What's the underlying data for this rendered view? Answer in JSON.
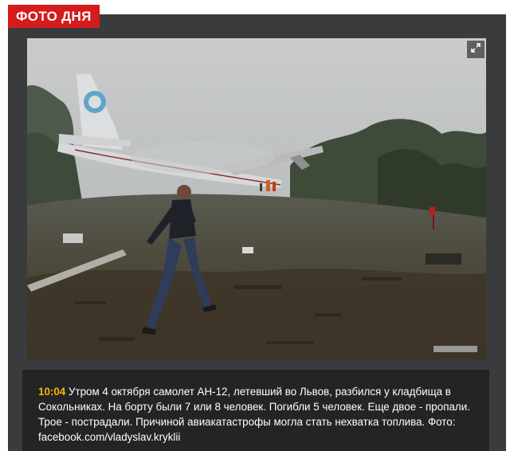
{
  "badge": {
    "label": "ФОТО ДНЯ"
  },
  "photo": {
    "icon": "expand-icon",
    "alt_description": ""
  },
  "caption": {
    "time": "10:04",
    "text": " Утром 4 октября самолет АН-12, летевший во Львов, разбился у кладбища в Сокольниках. На борту были 7 или 8 человек. Погибли 5 человек. Еще двое - пропали. Трое - пострадали. Причиной авиакатастрофы могла стать нехватка топлива. Фото: ",
    "link_text": "facebook.com/vladyslav.kryklii"
  },
  "colors": {
    "badge_bg": "#d51b1b",
    "panel_bg": "#3a3b3c",
    "caption_bg": "#232425",
    "time_color": "#f5b50a"
  }
}
